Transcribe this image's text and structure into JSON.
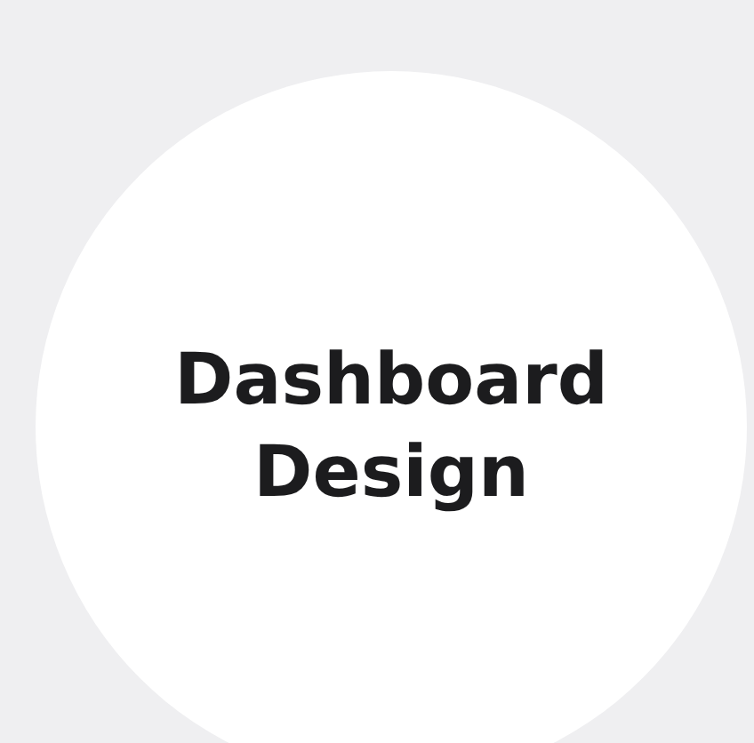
{
  "title": "Dashboard Design"
}
